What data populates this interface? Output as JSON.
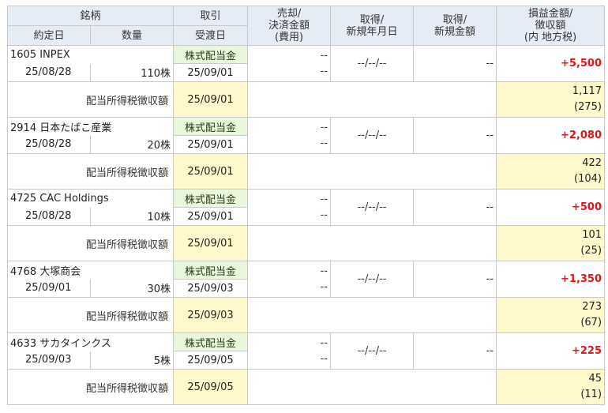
{
  "headers": {
    "stock": "銘柄",
    "trade_date": "約定日",
    "quantity": "数量",
    "trade": "取引",
    "settlement_date": "受渡日",
    "sale_line1": "売却/",
    "sale_line2": "決済金額",
    "sale_line3": "(費用)",
    "acq_date_line1": "取得/",
    "acq_date_line2": "新規年月日",
    "acq_amount_line1": "取得/",
    "acq_amount_line2": "新規金額",
    "pnl_line1": "損益金額/",
    "pnl_line2": "徴収額",
    "pnl_line3": "(内 地方税)"
  },
  "rows": [
    {
      "name": "1605 INPEX",
      "trade_date": "25/08/28",
      "quantity": "110株",
      "type": "株式配当金",
      "settle_date": "25/09/01",
      "sale_amount": "--",
      "sale_cost": "--",
      "acq_date": "--/--/--",
      "acq_amount": "--",
      "pnl": "+5,500",
      "tax_label": "配当所得税徴収額",
      "tax_date": "25/09/01",
      "tax_amount": "1,117",
      "tax_local": "(275)"
    },
    {
      "name": "2914 日本たばこ産業",
      "trade_date": "25/08/28",
      "quantity": "20株",
      "type": "株式配当金",
      "settle_date": "25/09/01",
      "sale_amount": "--",
      "sale_cost": "--",
      "acq_date": "--/--/--",
      "acq_amount": "--",
      "pnl": "+2,080",
      "tax_label": "配当所得税徴収額",
      "tax_date": "25/09/01",
      "tax_amount": "422",
      "tax_local": "(104)"
    },
    {
      "name": "4725 CAC Holdings",
      "trade_date": "25/08/28",
      "quantity": "10株",
      "type": "株式配当金",
      "settle_date": "25/09/01",
      "sale_amount": "--",
      "sale_cost": "--",
      "acq_date": "--/--/--",
      "acq_amount": "--",
      "pnl": "+500",
      "tax_label": "配当所得税徴収額",
      "tax_date": "25/09/01",
      "tax_amount": "101",
      "tax_local": "(25)"
    },
    {
      "name": "4768 大塚商会",
      "trade_date": "25/09/01",
      "quantity": "30株",
      "type": "株式配当金",
      "settle_date": "25/09/03",
      "sale_amount": "--",
      "sale_cost": "--",
      "acq_date": "--/--/--",
      "acq_amount": "--",
      "pnl": "+1,350",
      "tax_label": "配当所得税徴収額",
      "tax_date": "25/09/03",
      "tax_amount": "273",
      "tax_local": "(67)"
    },
    {
      "name": "4633 サカタインクス",
      "trade_date": "25/09/03",
      "quantity": "5株",
      "type": "株式配当金",
      "settle_date": "25/09/05",
      "sale_amount": "--",
      "sale_cost": "--",
      "acq_date": "--/--/--",
      "acq_amount": "--",
      "pnl": "+225",
      "tax_label": "配当所得税徴収額",
      "tax_date": "25/09/05",
      "tax_amount": "45",
      "tax_local": "(11)"
    }
  ]
}
